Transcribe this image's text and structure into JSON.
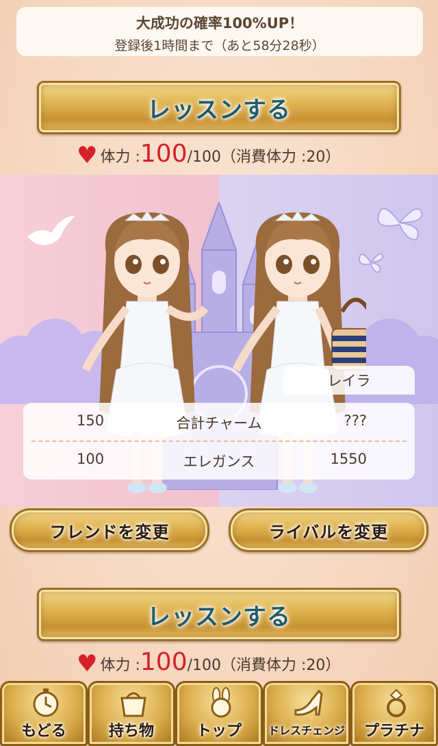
{
  "banner": {
    "line1": "大成功の確率100%UP！",
    "line2": "登録後1時間まで（あと58分28秒）"
  },
  "lesson_top": {
    "label": "レッスンする"
  },
  "stamina_top": {
    "label": "体力 :",
    "current": "100",
    "rest": "/100（消費体力 :20）"
  },
  "rival": {
    "name": "レイラ"
  },
  "stats": [
    {
      "friend": "150",
      "label": "合計チャーム",
      "rival": "???"
    },
    {
      "friend": "100",
      "label": "エレガンス",
      "rival": "1550"
    }
  ],
  "change_friend": {
    "label": "フレンドを変更"
  },
  "change_rival": {
    "label": "ライバルを変更"
  },
  "lesson_bottom": {
    "label": "レッスンする"
  },
  "stamina_bottom": {
    "label": "体力 :",
    "current": "100",
    "rest": "/100（消費体力 :20）"
  },
  "nav": [
    {
      "label": "もどる",
      "icon": "clock-icon"
    },
    {
      "label": "持ち物",
      "icon": "bag-icon"
    },
    {
      "label": "トップ",
      "icon": "bunny-icon"
    },
    {
      "label": "ドレスチェンジ",
      "icon": "high-heel-icon"
    },
    {
      "label": "プラチナ",
      "icon": "ring-icon"
    }
  ],
  "colors": {
    "accent_red": "#d6202a",
    "gold": "#dcae4c",
    "title_teal": "#1f5c6e"
  }
}
